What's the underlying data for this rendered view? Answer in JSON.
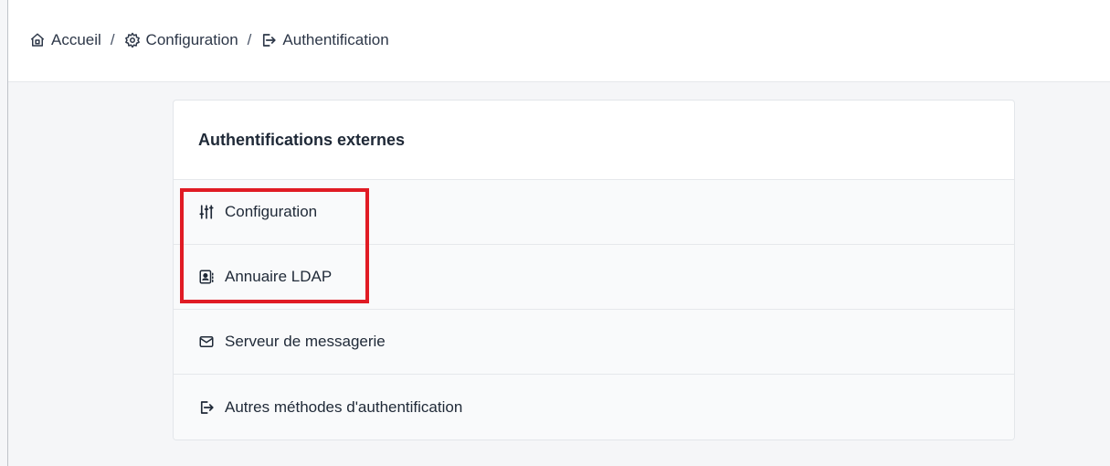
{
  "breadcrumb": {
    "items": [
      {
        "label": "Accueil",
        "icon": "home-icon"
      },
      {
        "label": "Configuration",
        "icon": "gear-icon"
      },
      {
        "label": "Authentification",
        "icon": "sign-in-icon"
      }
    ],
    "separator": "/"
  },
  "card": {
    "title": "Authentifications externes",
    "items": [
      {
        "label": "Configuration",
        "icon": "sliders-icon"
      },
      {
        "label": "Annuaire LDAP",
        "icon": "address-book-icon"
      },
      {
        "label": "Serveur de messagerie",
        "icon": "envelope-icon"
      },
      {
        "label": "Autres méthodes d'authentification",
        "icon": "sign-in-icon"
      }
    ]
  },
  "colors": {
    "highlight": "#e01b24",
    "background": "#f5f6f8",
    "card": "#ffffff",
    "text": "#1f2937"
  }
}
